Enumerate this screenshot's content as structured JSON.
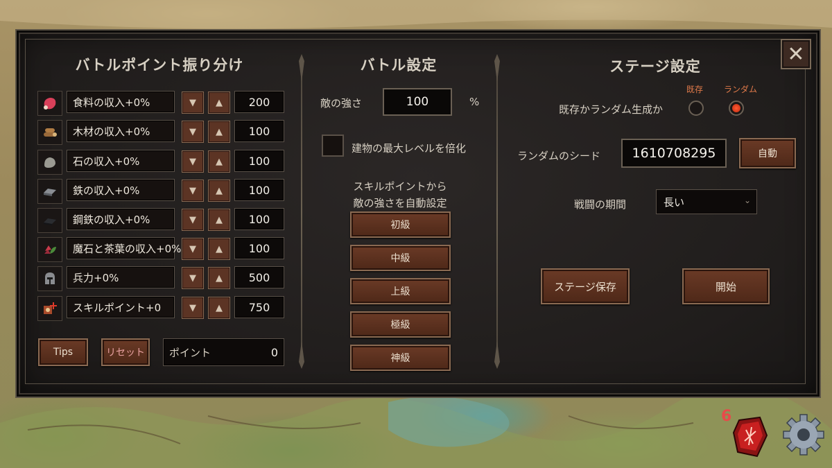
{
  "left": {
    "title": "バトルポイント振り分け",
    "rows": [
      {
        "label": "食料の収入+0%",
        "value": "200",
        "icon": "meat-icon"
      },
      {
        "label": "木材の収入+0%",
        "value": "100",
        "icon": "wood-icon"
      },
      {
        "label": "石の収入+0%",
        "value": "100",
        "icon": "stone-icon"
      },
      {
        "label": "鉄の収入+0%",
        "value": "100",
        "icon": "iron-icon"
      },
      {
        "label": "鋼鉄の収入+0%",
        "value": "100",
        "icon": "steel-icon"
      },
      {
        "label": "魔石と茶葉の収入+0%",
        "value": "100",
        "icon": "magic-stone-tea-icon"
      },
      {
        "label": "兵力+0%",
        "value": "500",
        "icon": "helmet-icon"
      },
      {
        "label": "スキルポイント+0",
        "value": "750",
        "icon": "skill-point-icon"
      }
    ],
    "arrows": {
      "down": "▼",
      "up": "▲"
    },
    "tips_label": "Tips",
    "reset_label": "リセット",
    "points_label": "ポイント",
    "points_value": "0"
  },
  "middle": {
    "title": "バトル設定",
    "enemy_strength_label": "敵の強さ",
    "enemy_strength_value": "100",
    "percent": "%",
    "max_level_label": "建物の最大レベルを倍化",
    "auto_set_label_1": "スキルポイントから",
    "auto_set_label_2": "敵の強さを自動設定",
    "levels": [
      "初級",
      "中級",
      "上級",
      "極級",
      "神級"
    ]
  },
  "right": {
    "title": "ステージ設定",
    "existing_label": "既存",
    "random_label": "ランダム",
    "mode_question": "既存かランダム生成か",
    "selected_mode": "ランダム",
    "seed_label": "ランダムのシード",
    "seed_value": "1610708295",
    "auto_label": "自動",
    "duration_label": "戦闘の期間",
    "duration_value": "長い",
    "save_label": "ステージ保存",
    "start_label": "開始"
  },
  "close_symbol": "✕",
  "hud": {
    "notification_count": "6"
  },
  "colors": {
    "accent_red": "#e84a4a",
    "button_brown": "#5c3424",
    "radio_on": "#ff5a33"
  }
}
